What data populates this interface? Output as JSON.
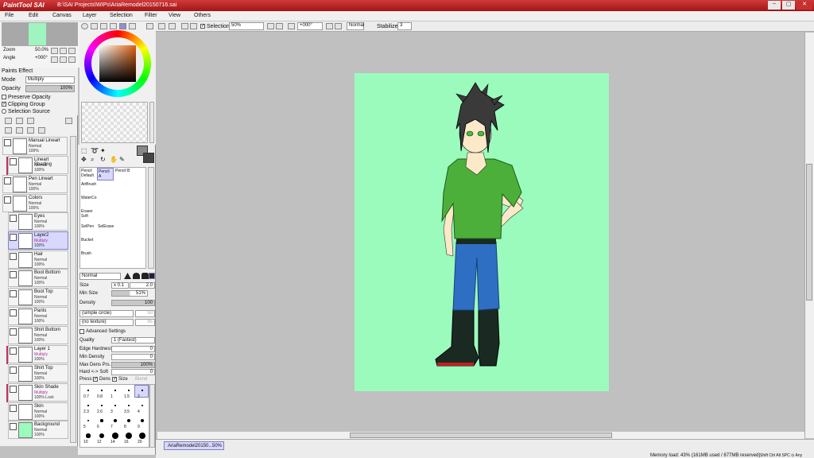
{
  "window": {
    "title": "B:\\SAI Projects\\WIPs\\AriaRemodel20150716.sai",
    "logo_text": "PaintTool SAI",
    "controls": [
      "–",
      "▢",
      "✕"
    ]
  },
  "menus": [
    "File",
    "Edit",
    "Canvas",
    "Layer",
    "Selection",
    "Filter",
    "View",
    "Others"
  ],
  "navigator": {
    "zoom_label": "Zoom",
    "zoom_value": "50.0%",
    "angle_label": "Angle",
    "angle_value": "+000°"
  },
  "paints_effect": {
    "header": "Paints Effect",
    "mode_label": "Mode",
    "mode_value": "Multiply",
    "opacity_label": "Opacity",
    "opacity_value": "100%",
    "preserve_opacity": "Preserve Opacity",
    "clipping_group": "Clipping Group",
    "selection_source": "Selection Source"
  },
  "layers": [
    {
      "name": "Manual Lineart",
      "mode": "Normal",
      "opacity": "100%",
      "folder": true
    },
    {
      "name": "Lineart Shading",
      "mode": "Normal",
      "opacity": "100%",
      "clip": true
    },
    {
      "name": "Pen Lineart",
      "mode": "Normal",
      "opacity": "100%",
      "folder": true
    },
    {
      "name": "Colors",
      "mode": "Normal",
      "opacity": "100%",
      "folder": true
    },
    {
      "name": "Eyes",
      "mode": "Normal",
      "opacity": "100%"
    },
    {
      "name": "Layer2",
      "mode": "Multiply",
      "opacity": "100%",
      "selected": true
    },
    {
      "name": "Hair",
      "mode": "Normal",
      "opacity": "100%"
    },
    {
      "name": "Boot Bottom",
      "mode": "Normal",
      "opacity": "100%"
    },
    {
      "name": "Boot Top",
      "mode": "Normal",
      "opacity": "100%"
    },
    {
      "name": "Pants",
      "mode": "Normal",
      "opacity": "100%"
    },
    {
      "name": "Shirt Bottom",
      "mode": "Normal",
      "opacity": "100%"
    },
    {
      "name": "Layer 1",
      "mode": "Multiply",
      "opacity": "100%",
      "clip": true
    },
    {
      "name": "Shirt Top",
      "mode": "Normal",
      "opacity": "100%"
    },
    {
      "name": "Skin Shade",
      "mode": "Multiply",
      "opacity": "100% Lock",
      "clip": true
    },
    {
      "name": "Skin",
      "mode": "Normal",
      "opacity": "100%"
    },
    {
      "name": "Background",
      "mode": "Normal",
      "opacity": "100%"
    }
  ],
  "tools": {
    "pencil_default": "Pencil Default",
    "pencil_a": "Pencil A",
    "pencil_b": "Pencil B",
    "airbrush": "AirBrush",
    "watercolor": "WaterCo",
    "eraser_soft": "Eraser Soft",
    "selpen": "SelPen",
    "selerase": "SelErase",
    "bucket": "Bucket",
    "brush": "Brush"
  },
  "brush_settings": {
    "blend_mode": "Normal",
    "size_label": "Size",
    "size_mult": "x 0.1",
    "size_value": "2.0",
    "min_size_label": "Min Size",
    "min_size_value": "51%",
    "density_label": "Density",
    "density_value": "100",
    "shape": "(simple circle)",
    "shape_value": "50",
    "texture": "(no texture)",
    "texture_value": "95",
    "advanced": "Advanced Settings",
    "quality_label": "Quality",
    "quality_value": "1 (Fastest)",
    "edge_hardness_label": "Edge Hardness",
    "edge_hardness_value": "0",
    "min_density_label": "Min Density",
    "min_density_value": "0",
    "max_dens_label": "Max Dens Prs.",
    "max_dens_value": "100%",
    "hard_soft_label": "Hard <-> Soft",
    "hard_soft_value": "0",
    "press_label": "Press:",
    "dens_label": "Dens",
    "size_check_label": "Size",
    "blend_label": "Blend"
  },
  "brush_sizes": [
    "0.7",
    "0.8",
    "1",
    "1.5",
    "2",
    "2.3",
    "2.6",
    "3",
    "3.5",
    "4",
    "5",
    "6",
    "7",
    "8",
    "9",
    "10",
    "12",
    "14",
    "16",
    "20"
  ],
  "toolbar": {
    "selection_label": "Selection",
    "zoom_value": "50%",
    "angle_value": "+000°",
    "mode_value": "Normal",
    "stabilizer_label": "Stabilizer",
    "stabilizer_value": "3"
  },
  "status": {
    "doc_tab": "AriaRemodel20150...",
    "doc_zoom": "50%",
    "memory": "Memory load: 43% (161MB used / 877MB reserved)",
    "keys": "Shift Ctrl Alt SPC ⊙ Any"
  },
  "colors": {
    "canvas_bg": "#9bfbbd",
    "shirt": "#4caf3a",
    "pants": "#2e6fc4",
    "boots": "#1a2a22",
    "hair": "#3a3a3a",
    "skin": "#fbe9c8"
  }
}
